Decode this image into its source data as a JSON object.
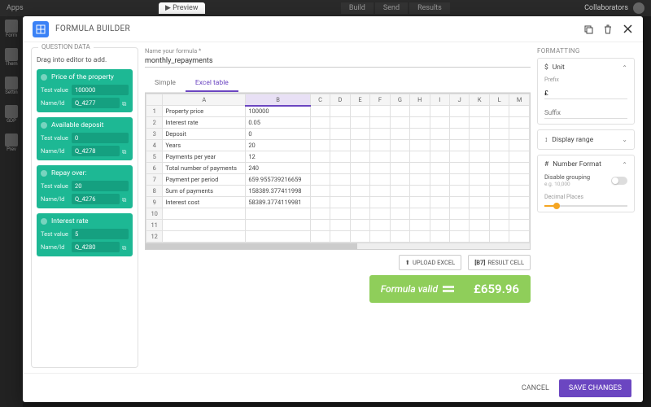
{
  "topbar": {
    "apps": "Apps",
    "preview": "Preview",
    "pills": [
      "Build",
      "Send",
      "Results"
    ],
    "collaborators": "Collaborators"
  },
  "leftbar": [
    "Form",
    "Them",
    "Settin",
    "GDP",
    "Prev"
  ],
  "modal": {
    "title": "FORMULA BUILDER",
    "cancel": "CANCEL",
    "save": "SAVE CHANGES"
  },
  "questionData": {
    "legend": "QUESTION DATA",
    "hint": "Drag into editor to add.",
    "cards": [
      {
        "title": "Price of the property",
        "testLabel": "Test value",
        "testValue": "100000",
        "idLabel": "Name/Id",
        "idValue": "Q_4277"
      },
      {
        "title": "Available deposit",
        "testLabel": "Test value",
        "testValue": "0",
        "idLabel": "Name/Id",
        "idValue": "Q_4278"
      },
      {
        "title": "Repay over:",
        "testLabel": "Test value",
        "testValue": "20",
        "idLabel": "Name/Id",
        "idValue": "Q_4276"
      },
      {
        "title": "Interest rate",
        "testLabel": "Test value",
        "testValue": "5",
        "idLabel": "Name/Id",
        "idValue": "Q_4280"
      }
    ]
  },
  "center": {
    "nameLabel": "Name your formula *",
    "nameValue": "monthly_repayments",
    "tabs": {
      "simple": "Simple",
      "excel": "Excel table"
    },
    "columns": [
      "A",
      "B",
      "C",
      "D",
      "E",
      "F",
      "G",
      "H",
      "I",
      "J",
      "K",
      "L",
      "M"
    ],
    "rows": [
      {
        "n": "1",
        "a": "Property price",
        "b": "100000"
      },
      {
        "n": "2",
        "a": "Interest rate",
        "b": "0.05"
      },
      {
        "n": "3",
        "a": "Deposit",
        "b": "0"
      },
      {
        "n": "4",
        "a": "Years",
        "b": "20"
      },
      {
        "n": "5",
        "a": "Payments per year",
        "b": "12"
      },
      {
        "n": "6",
        "a": "Total number of payments",
        "b": "240"
      },
      {
        "n": "7",
        "a": "Payment per period",
        "b": "659.955739216659"
      },
      {
        "n": "8",
        "a": "Sum of payments",
        "b": "158389.377411998"
      },
      {
        "n": "9",
        "a": "Interest cost",
        "b": "58389.3774119981"
      },
      {
        "n": "10",
        "a": "",
        "b": ""
      },
      {
        "n": "11",
        "a": "",
        "b": ""
      },
      {
        "n": "12",
        "a": "",
        "b": ""
      }
    ],
    "uploadExcel": "UPLOAD EXCEL",
    "resultCellRef": "[B7]",
    "resultCellLabel": "RESULT CELL",
    "validLabel": "Formula valid",
    "resultValue": "£659.96"
  },
  "formatting": {
    "heading": "FORMATTING",
    "unit": {
      "title": "Unit",
      "prefixLabel": "Prefix",
      "prefixValue": "£",
      "suffixLabel": "Suffix",
      "suffixValue": ""
    },
    "displayRange": "Display range",
    "numberFormat": {
      "title": "Number Format",
      "disableGrouping": "Disable grouping",
      "example": "e.g. 10,000",
      "decimalPlaces": "Decimal Places"
    }
  }
}
